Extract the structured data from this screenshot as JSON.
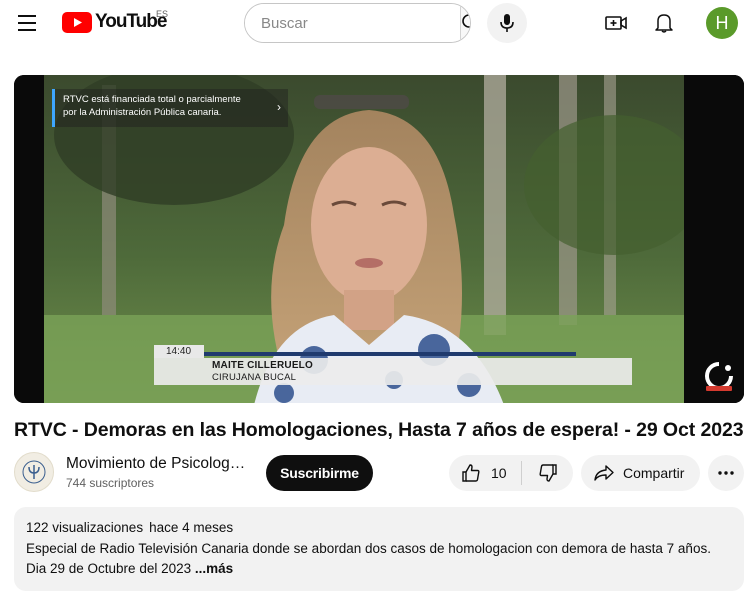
{
  "header": {
    "logo_text": "YouTube",
    "region": "ES",
    "search_placeholder": "Buscar",
    "avatar_letter": "H"
  },
  "video": {
    "overlay_notice_line1": "RTVC está financiada total o parcialmente",
    "overlay_notice_line2": "por la Administración Pública canaria.",
    "time_overlay": "14:40",
    "lower_third_name": "MAITE CILLERUELO",
    "lower_third_role": "CIRUJANA BUCAL",
    "title": "RTVC - Demoras en las Homologaciones, Hasta 7 años de espera! - 29 Oct 2023"
  },
  "channel": {
    "name": "Movimiento de Psicologos...",
    "subscribers": "744 suscriptores",
    "subscribe_label": "Suscribirme"
  },
  "actions": {
    "like_count": "10",
    "share_label": "Compartir"
  },
  "description": {
    "views": "122 visualizaciones",
    "date": "hace 4 meses",
    "line1": "Especial de Radio Televisión Canaria donde se abordan dos casos de homologacion con demora de hasta 7 años.",
    "line2": "Dia 29 de Octubre del 2023 ",
    "more": "...más"
  },
  "colors": {
    "brand_red": "#ff0000",
    "avatar_green": "#5a9a2a",
    "subscribe_bg": "#0f0f0f",
    "chip_bg": "#f2f2f2"
  }
}
